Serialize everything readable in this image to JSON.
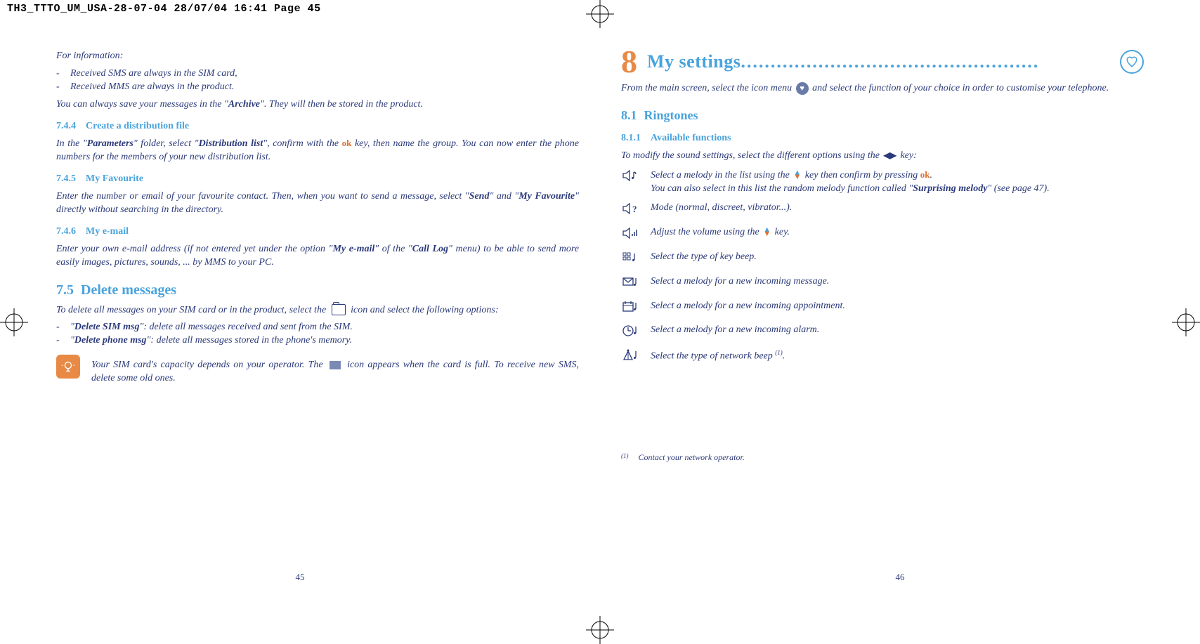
{
  "print_header": "TH3_TTTO_UM_USA-28-07-04  28/07/04  16:41  Page 45",
  "left": {
    "info_heading": "For information:",
    "info_items": [
      "Received SMS are always in the SIM card,",
      "Received MMS are always in the product."
    ],
    "archive_line_pre": "You can always save your messages in the \"",
    "archive_bold": "Archive",
    "archive_line_post": "\". They will then be stored in the product.",
    "s744_num": "7.4.4",
    "s744_title": "Create a distribution file",
    "s744_body_1a": "In the \"",
    "s744_body_1b": "Parameters",
    "s744_body_1c": "\" folder, select \"",
    "s744_body_1d": "Distribution list",
    "s744_body_1e": "\", confirm with the ",
    "s744_body_1f": " key, then name the group. You can now enter the phone numbers for the members of your new distribution list.",
    "ok": "ok",
    "s745_num": "7.4.5",
    "s745_title": "My Favourite",
    "s745_body_a": "Enter the number or email of your favourite contact. Then, when you want to send a message, select \"",
    "s745_body_b": "Send",
    "s745_body_c": "\" and \"",
    "s745_body_d": "My Favourite",
    "s745_body_e": "\" directly without searching in the directory.",
    "s746_num": "7.4.6",
    "s746_title": "My e-mail",
    "s746_body_a": "Enter your own e-mail address (if not entered yet under the option \"",
    "s746_body_b": "My e-mail",
    "s746_body_c": "\" of the \"",
    "s746_body_d": "Call Log",
    "s746_body_e": "\" menu) to be able to send more easily images, pictures, sounds, ... by MMS to your PC.",
    "s75_num": "7.5",
    "s75_title": "Delete messages",
    "s75_intro_a": "To delete all messages on your SIM card or in the product, select the ",
    "s75_intro_b": " icon and select the following options:",
    "s75_items": [
      {
        "pre": "\"",
        "b": "Delete SIM msg",
        "post": "\": delete all messages received and sent from the SIM."
      },
      {
        "pre": "\"",
        "b": "Delete phone msg",
        "post": "\": delete all messages stored in the phone's memory."
      }
    ],
    "tip_a": "Your SIM card's capacity depends on your operator. The ",
    "tip_b": " icon appears when the card is full. To receive new SMS, delete some old ones.",
    "page_num": "45"
  },
  "right": {
    "chapter_num": "8",
    "chapter_title": "My settings",
    "intro_a": "From the main screen, select the icon menu ",
    "intro_b": " and select the function of your choice in order to customise your telephone.",
    "s81_num": "8.1",
    "s81_title": "Ringtones",
    "s811_num": "8.1.1",
    "s811_title": "Available functions",
    "s811_intro_a": "To modify the sound settings, select the different options using the ",
    "s811_intro_b": " key:",
    "funcs": {
      "f0a": "Select a melody in the list using the ",
      "f0b": " key then confirm by pressing ",
      "f0c": ".",
      "f0d": "You can also select in this list the random melody function called \"",
      "f0e": "Surprising melody",
      "f0f": "\" (see page 47).",
      "f1": "Mode (normal, discreet, vibrator...).",
      "f2a": "Adjust the volume using the ",
      "f2b": " key.",
      "f3": "Select the type of key beep.",
      "f4": "Select a melody for a new incoming message.",
      "f5": "Select a melody for a new incoming appointment.",
      "f6": "Select a melody for a new incoming alarm.",
      "f7a": "Select the type of network beep ",
      "f7b": "(1)",
      "f7c": "."
    },
    "footnote_mark": "(1)",
    "footnote_text": "Contact your network operator.",
    "page_num": "46"
  }
}
